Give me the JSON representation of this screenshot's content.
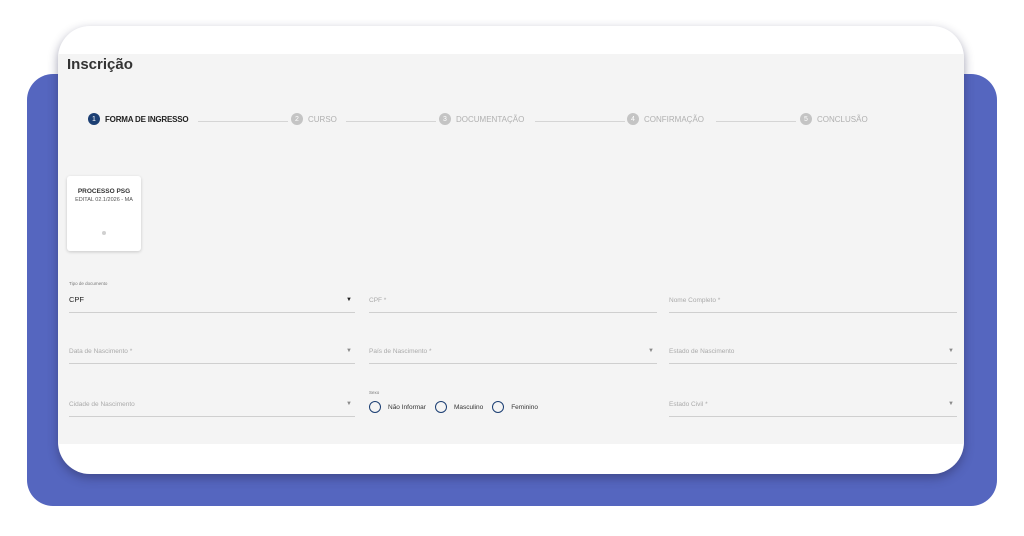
{
  "page": {
    "title": "Inscrição"
  },
  "stepper": [
    {
      "number": "1",
      "label": "FORMA DE INGRESSO",
      "active": true
    },
    {
      "number": "2",
      "label": "CURSO",
      "active": false
    },
    {
      "number": "3",
      "label": "DOCUMENTAÇÃO",
      "active": false
    },
    {
      "number": "4",
      "label": "CONFIRMAÇÃO",
      "active": false
    },
    {
      "number": "5",
      "label": "CONCLUSÃO",
      "active": false
    }
  ],
  "process_card": {
    "title": "PROCESSO PSG",
    "subtitle": "EDITAL 02.1/2026 - MA"
  },
  "form": {
    "tipo_documento": {
      "label": "Tipo de documento",
      "value": "CPF"
    },
    "cpf": {
      "placeholder": "CPF *"
    },
    "nome_completo": {
      "placeholder": "Nome Completo *"
    },
    "data_nascimento": {
      "placeholder": "Data de Nascimento *"
    },
    "pais_nascimento": {
      "placeholder": "País de Nascimento *"
    },
    "estado_nascimento": {
      "placeholder": "Estado de Nascimento"
    },
    "cidade_nascimento": {
      "placeholder": "Cidade de Nascimento"
    },
    "sexo": {
      "label": "Sexo",
      "options": [
        "Não Informar",
        "Masculino",
        "Feminino"
      ]
    },
    "estado_civil": {
      "placeholder": "Estado Civil *"
    }
  },
  "icons": {
    "dropdown": "▼"
  },
  "colors": {
    "accent": "#1c3f73",
    "background_shape": "#5566bf",
    "form_bg": "#f4f4f4"
  }
}
